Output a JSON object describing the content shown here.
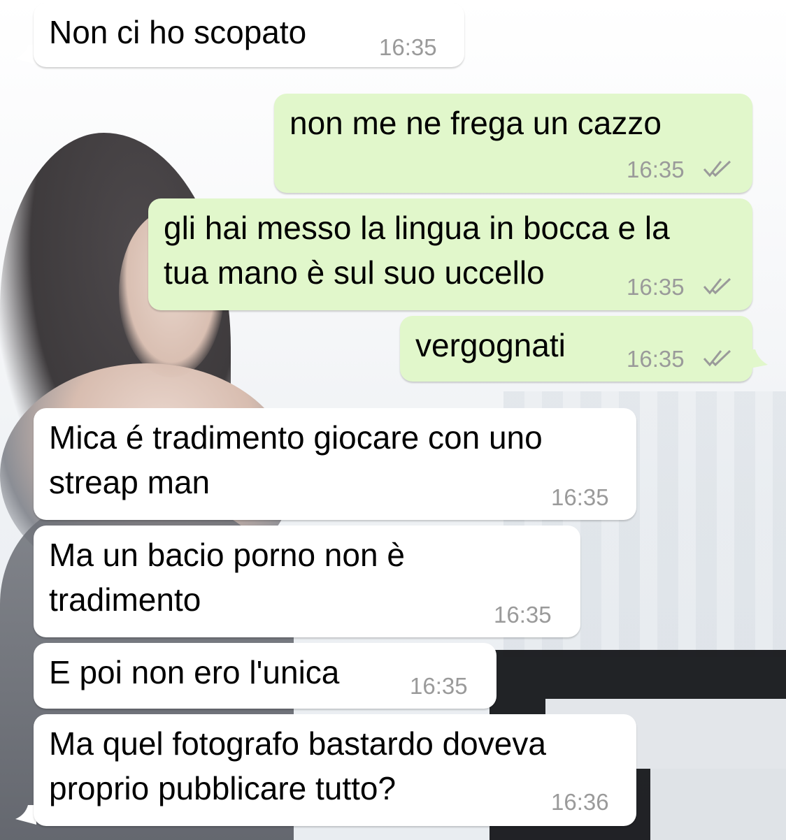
{
  "messages": [
    {
      "direction": "incoming",
      "text": "Non ci ho scopato",
      "time": "16:35"
    },
    {
      "direction": "outgoing",
      "text": "non me ne frega un cazzo",
      "time": "16:35",
      "status": "read"
    },
    {
      "direction": "outgoing",
      "text": "gli hai messo la lingua in bocca e la\ntua mano è sul suo uccello",
      "time": "16:35",
      "status": "read"
    },
    {
      "direction": "outgoing",
      "text": "vergognati",
      "time": "16:35",
      "status": "read"
    },
    {
      "direction": "incoming",
      "text": "Mica é tradimento giocare con uno\nstreap man",
      "time": "16:35"
    },
    {
      "direction": "incoming",
      "text": "Ma un bacio porno non è\ntradimento",
      "time": "16:35"
    },
    {
      "direction": "incoming",
      "text": "E poi non ero l'unica",
      "time": "16:35"
    },
    {
      "direction": "incoming",
      "text": "Ma quel fotografo bastardo doveva\nproprio pubblicare tutto?",
      "time": "16:36"
    }
  ],
  "colors": {
    "incoming_bubble": "#ffffff",
    "outgoing_bubble": "#e1f7cb",
    "timestamp": "#9a9a9a",
    "read_checks": "#9a9a9a"
  },
  "icons": {
    "read_receipt": "double-check-icon"
  }
}
